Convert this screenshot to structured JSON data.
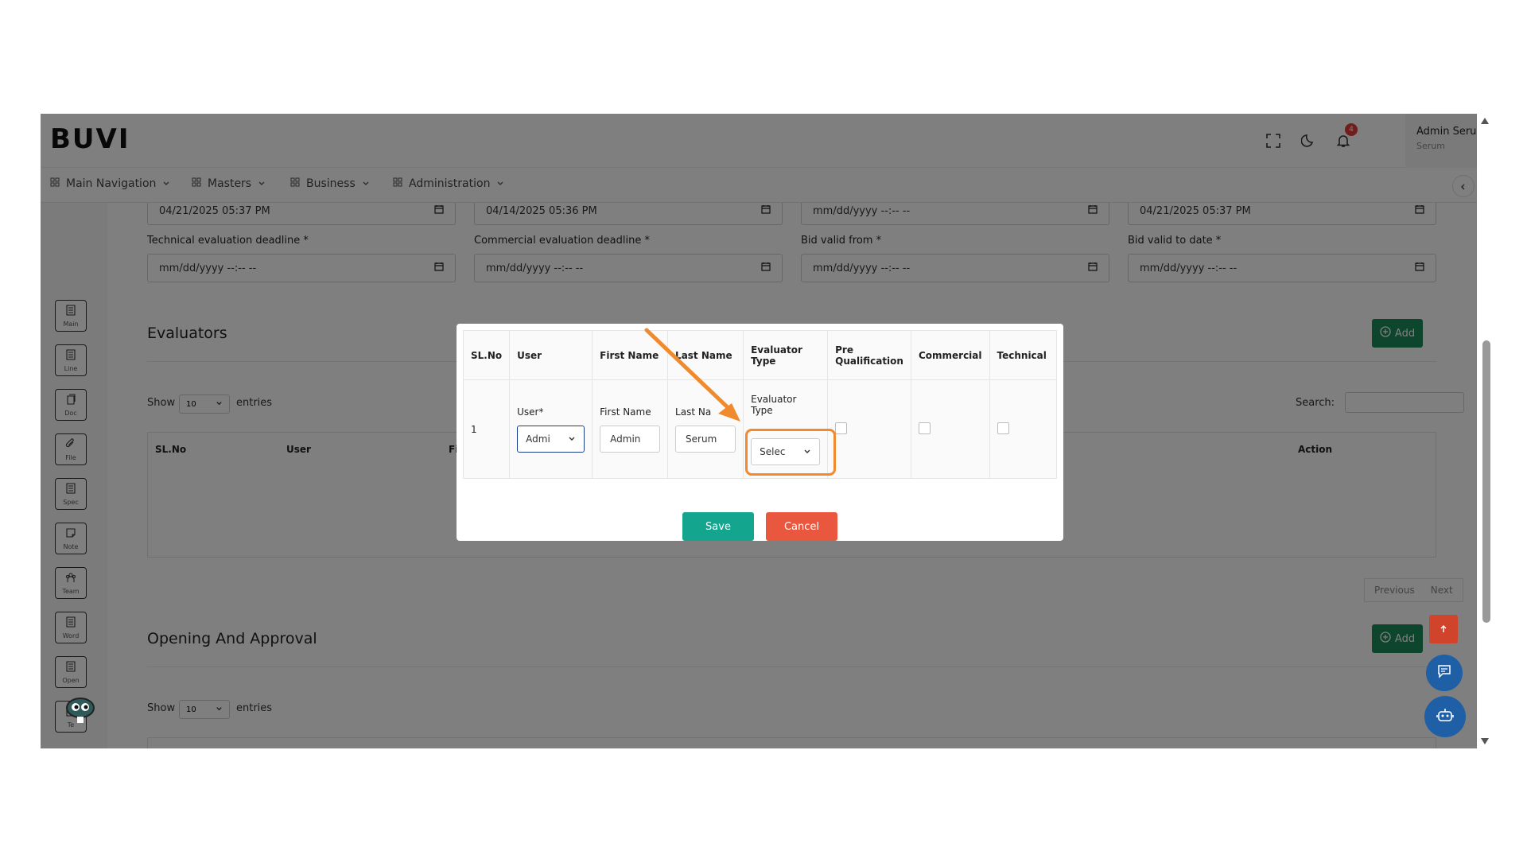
{
  "header": {
    "logo": "BUVI",
    "notification_count": "4",
    "user_name": "Admin Serum",
    "user_sub": "Serum"
  },
  "nav": {
    "items": [
      "Main Navigation",
      "Masters",
      "Business",
      "Administration"
    ]
  },
  "sidebar": {
    "items": [
      "Main",
      "Line",
      "Doc",
      "File",
      "Spec",
      "Note",
      "Team",
      "Word",
      "Open",
      "Te"
    ]
  },
  "dates": {
    "row1": [
      "04/21/2025 05:37 PM",
      "04/14/2025 05:36 PM",
      "mm/dd/yyyy --:-- --",
      "04/21/2025 05:37 PM"
    ],
    "labels2": [
      "Technical evaluation deadline *",
      "Commercial evaluation deadline *",
      "Bid valid from *",
      "Bid valid to date *"
    ],
    "row2": [
      "mm/dd/yyyy --:-- --",
      "mm/dd/yyyy --:-- --",
      "mm/dd/yyyy --:-- --",
      "mm/dd/yyyy --:-- --"
    ]
  },
  "evaluators": {
    "title": "Evaluators",
    "add_label": "Add",
    "show_label": "Show",
    "entries_value": "10",
    "entries_label": "entries",
    "search_label": "Search:",
    "columns": [
      "SL.No",
      "User",
      "First",
      "Action"
    ],
    "prev_label": "Previous",
    "next_label": "Next"
  },
  "opening": {
    "title": "Opening And Approval",
    "add_label": "Add",
    "show_label": "Show",
    "entries_value": "10",
    "entries_label": "entries"
  },
  "modal": {
    "headers": [
      "SL.No",
      "User",
      "First Name",
      "Last Name",
      "Evaluator Type",
      "Pre Qualification",
      "Commercial",
      "Technical"
    ],
    "row": {
      "slno": "1",
      "user_label": "User*",
      "user_value": "Admi",
      "first_label": "First Name",
      "first_value": "Admin",
      "last_label": "Last Na",
      "last_value": "Serum",
      "eval_label": "Evaluator Type",
      "eval_value": "Selec"
    },
    "save_label": "Save",
    "cancel_label": "Cancel"
  },
  "colors": {
    "add_green": "#1a8a5a",
    "save_teal": "#14a58e",
    "cancel_red": "#e8573e",
    "highlight_orange": "#f08a2c"
  }
}
